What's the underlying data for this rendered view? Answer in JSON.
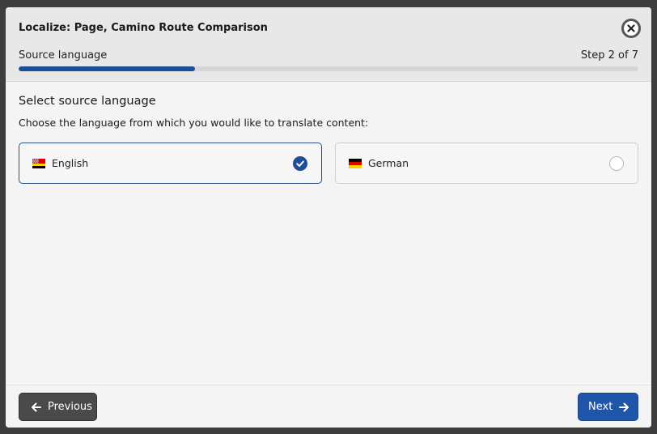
{
  "dialog": {
    "title": "Localize: Page, Camino Route Comparison",
    "step_label": "Source language",
    "step_count": "Step 2 of 7",
    "progress_percent": 28.5
  },
  "content": {
    "heading": "Select source language",
    "description": "Choose the language from which you would like to translate content:"
  },
  "languages": [
    {
      "label": "English",
      "flag": "uk-flag-icon",
      "selected": true
    },
    {
      "label": "German",
      "flag": "germany-flag-icon",
      "selected": false
    }
  ],
  "footer": {
    "previous_label": "Previous",
    "next_label": "Next"
  },
  "colors": {
    "accent": "#1f4e99",
    "next_button": "#1f56a8",
    "previous_button": "#4a4a4a"
  }
}
